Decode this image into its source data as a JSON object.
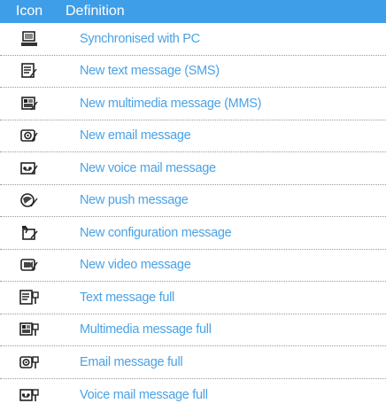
{
  "header": {
    "icon_col": "Icon",
    "definition_col": "Definition"
  },
  "rows": [
    {
      "icon": "pc-sync-icon",
      "definition": "Synchronised with PC"
    },
    {
      "icon": "sms-icon",
      "definition": "New text message (SMS)"
    },
    {
      "icon": "mms-icon",
      "definition": "New multimedia message (MMS)"
    },
    {
      "icon": "email-icon",
      "definition": "New email message"
    },
    {
      "icon": "voicemail-icon",
      "definition": "New voice mail message"
    },
    {
      "icon": "push-message-icon",
      "definition": "New push message"
    },
    {
      "icon": "configuration-message-icon",
      "definition": "New configuration message"
    },
    {
      "icon": "video-message-icon",
      "definition": "New video message"
    },
    {
      "icon": "text-full-icon",
      "definition": "Text message full"
    },
    {
      "icon": "multimedia-full-icon",
      "definition": "Multimedia message full"
    },
    {
      "icon": "email-full-icon",
      "definition": "Email message full"
    },
    {
      "icon": "voicemail-full-icon",
      "definition": "Voice mail message full"
    }
  ],
  "colors": {
    "header_bg": "#3f9ee8",
    "header_text": "#ffffff",
    "definition_text": "#4aa2e6"
  }
}
